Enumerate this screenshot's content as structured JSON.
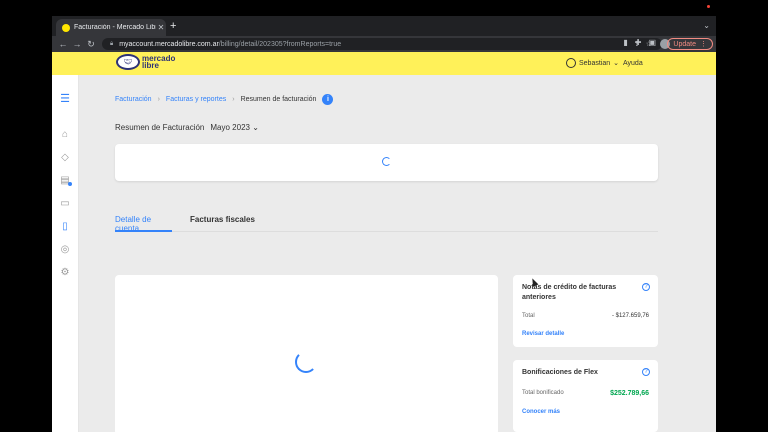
{
  "browser": {
    "tab_title": "Facturación - Mercado Libre",
    "tab_close": "✕",
    "new_tab": "+",
    "url_host": "myaccount.mercadolibre.com.ar",
    "url_path": "/billing/detail/202305?fromReports=true",
    "update_label": "Update",
    "more": "⋮"
  },
  "header": {
    "logo_line1": "mercado",
    "logo_line2": "libre",
    "user_name": "Sebastian",
    "help": "Ayuda"
  },
  "breadcrumb": {
    "items": [
      "Facturación",
      "Facturas y reportes"
    ],
    "current": "Resumen de facturación",
    "info": "i"
  },
  "summary": {
    "label": "Resumen de Facturación",
    "period": "Mayo 2023"
  },
  "tabs": {
    "active": "Detalle de cuenta",
    "inactive": "Facturas fiscales"
  },
  "credit_notes": {
    "title": "Notas de crédito de facturas anteriores",
    "total_label": "Total",
    "total_value": "- $127.659,76",
    "link": "Revisar detalle"
  },
  "flex": {
    "title": "Bonificaciones de Flex",
    "total_label": "Total bonificado",
    "total_value": "$252.789,66",
    "link": "Conocer más"
  },
  "colors": {
    "brand_yellow": "#fff159",
    "accent_blue": "#3483fa",
    "positive_green": "#00a650"
  }
}
